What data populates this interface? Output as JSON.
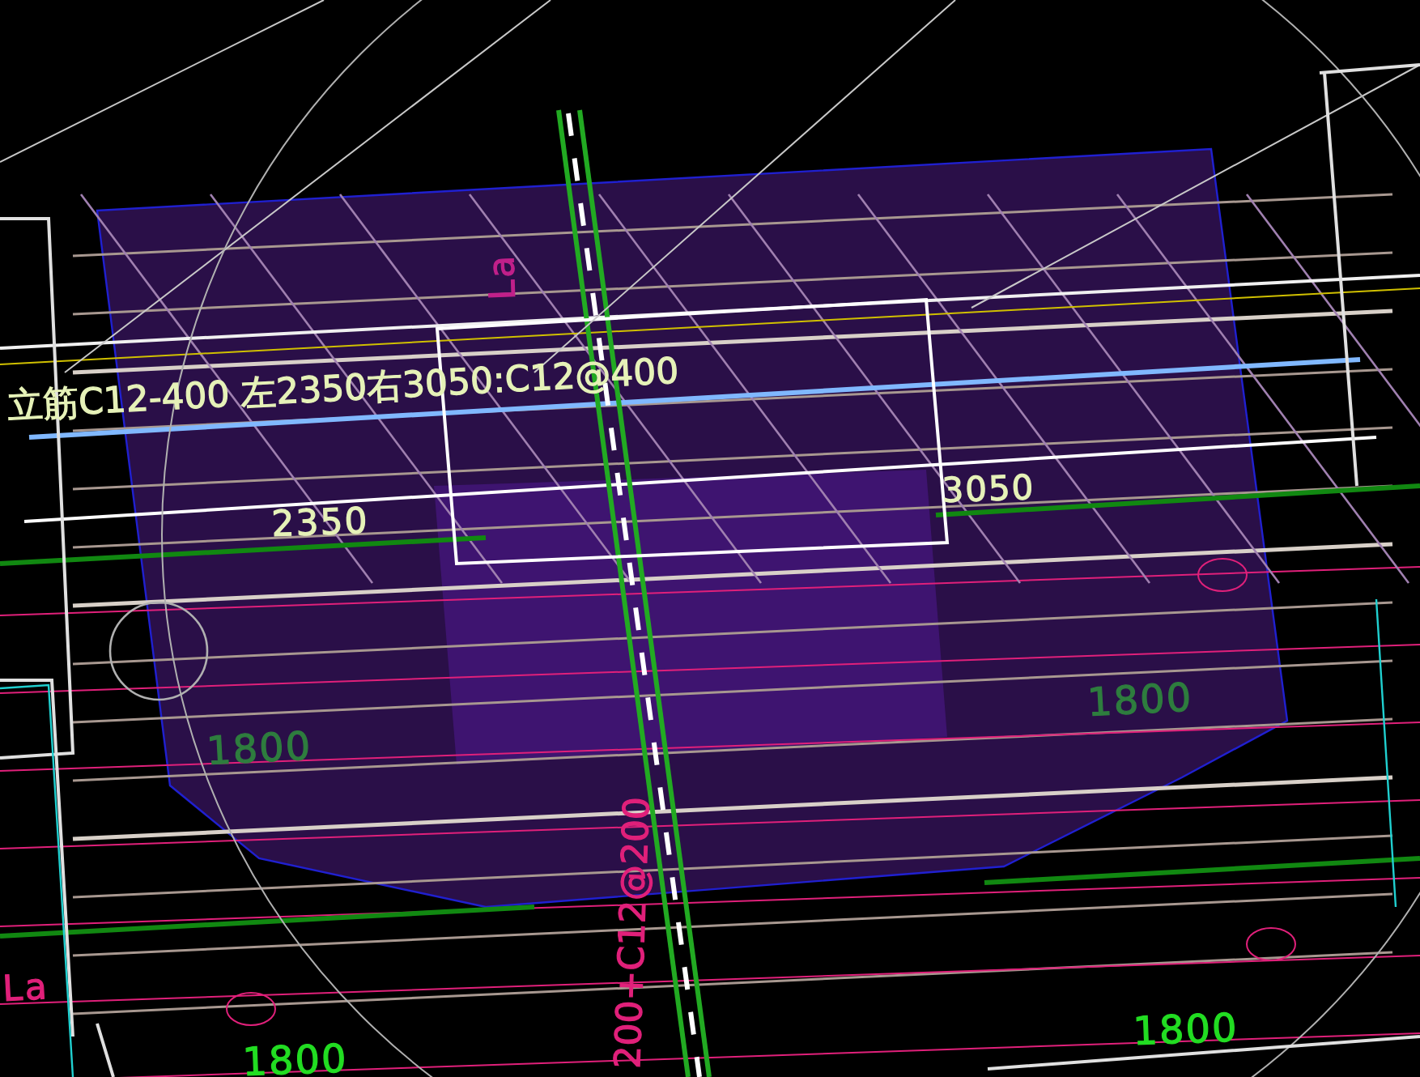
{
  "viewport": {
    "annotations": [
      {
        "kind": "note",
        "text": "立筋C12-400 左2350右3050:C12@400",
        "color": "#e6f2b8"
      },
      {
        "kind": "tag",
        "text": "La",
        "color": "#c0208a"
      },
      {
        "kind": "dimension",
        "text": "2350",
        "color": "#e6f2b8"
      },
      {
        "kind": "dimension",
        "text": "3050",
        "color": "#e6f2b8"
      },
      {
        "kind": "dimension",
        "text": "1800",
        "color": "#2e7d3e"
      },
      {
        "kind": "dimension",
        "text": "1800",
        "color": "#2e7d3e"
      },
      {
        "kind": "note",
        "text": "200+C12@200",
        "color": "#e0207a"
      },
      {
        "kind": "tag",
        "text": "La",
        "color": "#e0207a"
      },
      {
        "kind": "dimension",
        "text": "1800",
        "color": "#22dd22"
      },
      {
        "kind": "dimension",
        "text": "1800",
        "color": "#22dd22"
      }
    ]
  }
}
